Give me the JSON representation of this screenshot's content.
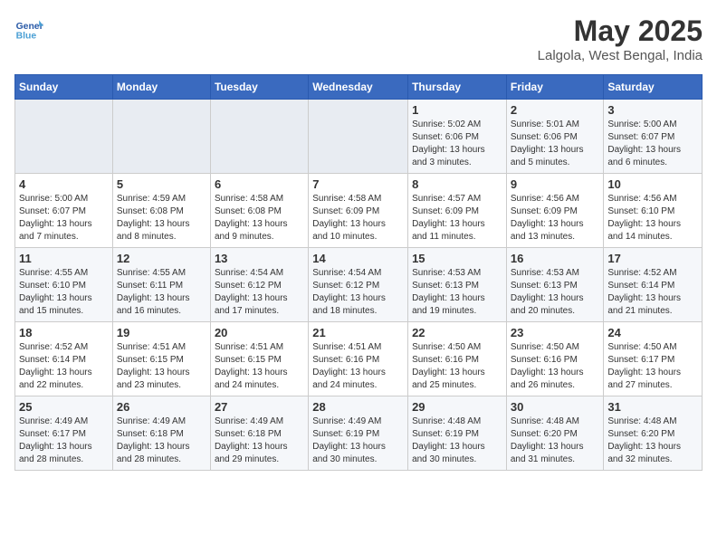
{
  "header": {
    "logo_line1": "General",
    "logo_line2": "Blue",
    "month": "May 2025",
    "location": "Lalgola, West Bengal, India"
  },
  "weekdays": [
    "Sunday",
    "Monday",
    "Tuesday",
    "Wednesday",
    "Thursday",
    "Friday",
    "Saturday"
  ],
  "weeks": [
    [
      {
        "day": "",
        "info": ""
      },
      {
        "day": "",
        "info": ""
      },
      {
        "day": "",
        "info": ""
      },
      {
        "day": "",
        "info": ""
      },
      {
        "day": "1",
        "info": "Sunrise: 5:02 AM\nSunset: 6:06 PM\nDaylight: 13 hours\nand 3 minutes."
      },
      {
        "day": "2",
        "info": "Sunrise: 5:01 AM\nSunset: 6:06 PM\nDaylight: 13 hours\nand 5 minutes."
      },
      {
        "day": "3",
        "info": "Sunrise: 5:00 AM\nSunset: 6:07 PM\nDaylight: 13 hours\nand 6 minutes."
      }
    ],
    [
      {
        "day": "4",
        "info": "Sunrise: 5:00 AM\nSunset: 6:07 PM\nDaylight: 13 hours\nand 7 minutes."
      },
      {
        "day": "5",
        "info": "Sunrise: 4:59 AM\nSunset: 6:08 PM\nDaylight: 13 hours\nand 8 minutes."
      },
      {
        "day": "6",
        "info": "Sunrise: 4:58 AM\nSunset: 6:08 PM\nDaylight: 13 hours\nand 9 minutes."
      },
      {
        "day": "7",
        "info": "Sunrise: 4:58 AM\nSunset: 6:09 PM\nDaylight: 13 hours\nand 10 minutes."
      },
      {
        "day": "8",
        "info": "Sunrise: 4:57 AM\nSunset: 6:09 PM\nDaylight: 13 hours\nand 11 minutes."
      },
      {
        "day": "9",
        "info": "Sunrise: 4:56 AM\nSunset: 6:09 PM\nDaylight: 13 hours\nand 13 minutes."
      },
      {
        "day": "10",
        "info": "Sunrise: 4:56 AM\nSunset: 6:10 PM\nDaylight: 13 hours\nand 14 minutes."
      }
    ],
    [
      {
        "day": "11",
        "info": "Sunrise: 4:55 AM\nSunset: 6:10 PM\nDaylight: 13 hours\nand 15 minutes."
      },
      {
        "day": "12",
        "info": "Sunrise: 4:55 AM\nSunset: 6:11 PM\nDaylight: 13 hours\nand 16 minutes."
      },
      {
        "day": "13",
        "info": "Sunrise: 4:54 AM\nSunset: 6:12 PM\nDaylight: 13 hours\nand 17 minutes."
      },
      {
        "day": "14",
        "info": "Sunrise: 4:54 AM\nSunset: 6:12 PM\nDaylight: 13 hours\nand 18 minutes."
      },
      {
        "day": "15",
        "info": "Sunrise: 4:53 AM\nSunset: 6:13 PM\nDaylight: 13 hours\nand 19 minutes."
      },
      {
        "day": "16",
        "info": "Sunrise: 4:53 AM\nSunset: 6:13 PM\nDaylight: 13 hours\nand 20 minutes."
      },
      {
        "day": "17",
        "info": "Sunrise: 4:52 AM\nSunset: 6:14 PM\nDaylight: 13 hours\nand 21 minutes."
      }
    ],
    [
      {
        "day": "18",
        "info": "Sunrise: 4:52 AM\nSunset: 6:14 PM\nDaylight: 13 hours\nand 22 minutes."
      },
      {
        "day": "19",
        "info": "Sunrise: 4:51 AM\nSunset: 6:15 PM\nDaylight: 13 hours\nand 23 minutes."
      },
      {
        "day": "20",
        "info": "Sunrise: 4:51 AM\nSunset: 6:15 PM\nDaylight: 13 hours\nand 24 minutes."
      },
      {
        "day": "21",
        "info": "Sunrise: 4:51 AM\nSunset: 6:16 PM\nDaylight: 13 hours\nand 24 minutes."
      },
      {
        "day": "22",
        "info": "Sunrise: 4:50 AM\nSunset: 6:16 PM\nDaylight: 13 hours\nand 25 minutes."
      },
      {
        "day": "23",
        "info": "Sunrise: 4:50 AM\nSunset: 6:16 PM\nDaylight: 13 hours\nand 26 minutes."
      },
      {
        "day": "24",
        "info": "Sunrise: 4:50 AM\nSunset: 6:17 PM\nDaylight: 13 hours\nand 27 minutes."
      }
    ],
    [
      {
        "day": "25",
        "info": "Sunrise: 4:49 AM\nSunset: 6:17 PM\nDaylight: 13 hours\nand 28 minutes."
      },
      {
        "day": "26",
        "info": "Sunrise: 4:49 AM\nSunset: 6:18 PM\nDaylight: 13 hours\nand 28 minutes."
      },
      {
        "day": "27",
        "info": "Sunrise: 4:49 AM\nSunset: 6:18 PM\nDaylight: 13 hours\nand 29 minutes."
      },
      {
        "day": "28",
        "info": "Sunrise: 4:49 AM\nSunset: 6:19 PM\nDaylight: 13 hours\nand 30 minutes."
      },
      {
        "day": "29",
        "info": "Sunrise: 4:48 AM\nSunset: 6:19 PM\nDaylight: 13 hours\nand 30 minutes."
      },
      {
        "day": "30",
        "info": "Sunrise: 4:48 AM\nSunset: 6:20 PM\nDaylight: 13 hours\nand 31 minutes."
      },
      {
        "day": "31",
        "info": "Sunrise: 4:48 AM\nSunset: 6:20 PM\nDaylight: 13 hours\nand 32 minutes."
      }
    ]
  ]
}
